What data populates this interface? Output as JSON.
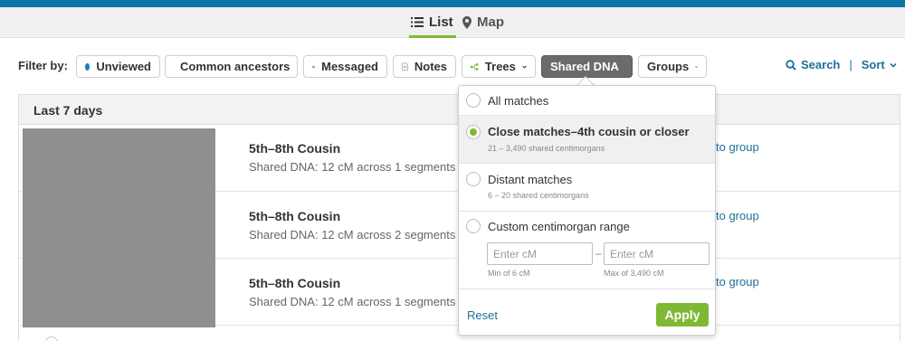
{
  "view_tabs": {
    "list": {
      "label": "List",
      "icon": "list-icon",
      "active": true
    },
    "map": {
      "label": "Map",
      "icon": "map-pin-icon"
    }
  },
  "filter": {
    "label": "Filter by:",
    "chips": [
      {
        "label": "Unviewed",
        "icon": "blue-dot-icon"
      },
      {
        "label": "Common ancestors",
        "icon": "leaf-icon"
      },
      {
        "label": "Messaged",
        "icon": "envelope-icon"
      },
      {
        "label": "Notes",
        "icon": "note-icon"
      },
      {
        "label": "Trees",
        "icon": "tree-icon",
        "dropdown": true
      },
      {
        "label": "Shared DNA",
        "active": true,
        "dropdown": true,
        "open": true
      },
      {
        "label": "Groups",
        "dropdown": true
      }
    ],
    "search_label": "Search",
    "separator": "|",
    "sort_label": "Sort"
  },
  "list": {
    "section_title": "Last 7 days",
    "rows": [
      {
        "title": "5th–8th Cousin",
        "dna": "Shared DNA: 12 cM across 1 segments",
        "group_link": "to group"
      },
      {
        "title": "5th–8th Cousin",
        "dna": "Shared DNA: 12 cM across 2 segments",
        "group_link": "to group"
      },
      {
        "title": "5th–8th Cousin",
        "dna": "Shared DNA: 12 cM across 1 segments",
        "group_link": "to group"
      }
    ]
  },
  "dna_dropdown": {
    "options": [
      {
        "label": "All matches",
        "sub": "",
        "selected": false
      },
      {
        "label": "Close matches–4th cousin or closer",
        "sub": "21 – 3,490 shared centimorgans",
        "selected": true
      },
      {
        "label": "Distant matches",
        "sub": "6 – 20 shared centimorgans",
        "selected": false
      },
      {
        "label": "Custom centimorgan range",
        "sub": "",
        "selected": false
      }
    ],
    "min_placeholder": "Enter cM",
    "max_placeholder": "Enter cM",
    "range_dash": "–",
    "min_hint": "Min of 6 cM",
    "max_hint": "Max of 3,490 cM",
    "reset_label": "Reset",
    "apply_label": "Apply"
  },
  "colors": {
    "brand_blue": "#0b75a8",
    "accent_green": "#7fb934",
    "link_blue": "#1f6f9b",
    "active_chip": "#6b6b6b"
  }
}
